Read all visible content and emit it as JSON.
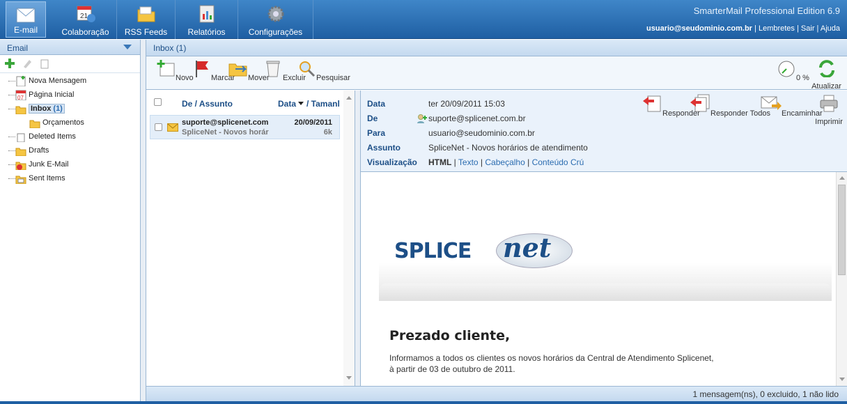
{
  "nav": {
    "items": [
      {
        "label": "E-mail",
        "icon": "email-icon"
      },
      {
        "label": "Colaboração",
        "icon": "calendar-icon"
      },
      {
        "label": "RSS Feeds",
        "icon": "rss-folder-icon"
      },
      {
        "label": "Relatórios",
        "icon": "reports-icon"
      },
      {
        "label": "Configurações",
        "icon": "gear-icon"
      }
    ],
    "brand": "SmarterMail Professional Edition 6.9",
    "user": "usuario@seudominio.com.br",
    "links": [
      "Lembretes",
      "Sair",
      "Ajuda"
    ],
    "sep": "|"
  },
  "sidebar": {
    "title": "Email",
    "tree": [
      {
        "label": "Nova Mensagem"
      },
      {
        "label": "Página Inicial"
      },
      {
        "label": "Inbox",
        "count": "(1)"
      },
      {
        "label": "Orçamentos"
      },
      {
        "label": "Deleted Items"
      },
      {
        "label": "Drafts"
      },
      {
        "label": "Junk E-Mail"
      },
      {
        "label": "Sent Items"
      }
    ],
    "calendar_day": "07"
  },
  "main": {
    "title": "Inbox (1)",
    "toolbar": [
      "Novo",
      "Marcar",
      "Mover",
      "Excluir",
      "Pesquisar"
    ],
    "toolbar_right": {
      "progress_label": "0 %",
      "refresh": "Atualizar",
      "progress": 0
    }
  },
  "list": {
    "col_from": "De / Assunto",
    "col_date": "Data",
    "col_size": "/ Tamanl",
    "messages": [
      {
        "from": "suporte@splicenet.com",
        "subject": "SpliceNet - Novos horár",
        "date": "20/09/2011",
        "size": "6k"
      }
    ]
  },
  "preview": {
    "labels": {
      "date": "Data",
      "from": "De",
      "to": "Para",
      "subject": "Assunto",
      "view": "Visualização"
    },
    "date": "ter 20/09/2011 15:03",
    "from": "suporte@splicenet.com.br",
    "to": "usuario@seudominio.com.br",
    "subject": "SpliceNet - Novos horários de atendimento",
    "views": {
      "html": "HTML",
      "text": "Texto",
      "header": "Cabeçalho",
      "raw": "Conteúdo Crú"
    },
    "actions": [
      "Responder",
      "Responder Todos",
      "Encaminhar",
      "Imprimir"
    ],
    "body": {
      "logo_a": "SPLICE",
      "logo_b": "net",
      "greeting": "Prezado cliente,",
      "line1": "Informamos a todos os clientes os novos horários da Central de Atendimento Splicenet,",
      "line2": "à partir de 03 de outubro de 2011."
    }
  },
  "status": "1 mensagem(ns), 0 excluido, 1 não lido"
}
